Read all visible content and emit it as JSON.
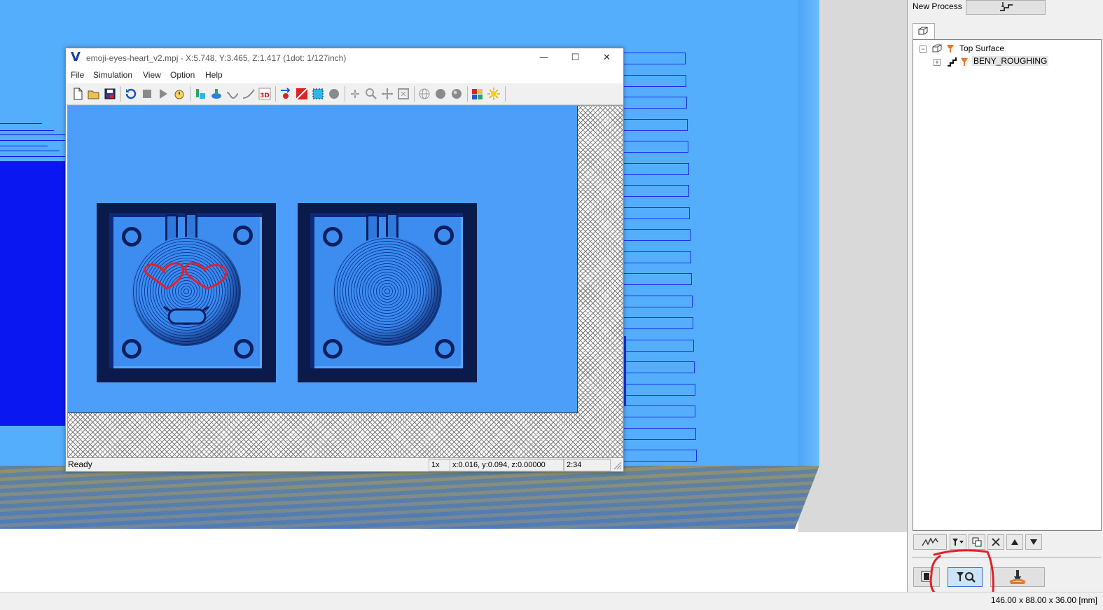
{
  "sim_window": {
    "title": "emoji-eyes-heart_v2.mpj - X:5.748, Y:3.465, Z:1.417 (1dot: 1/127inch)",
    "controls": {
      "minimize": "—",
      "maximize": "☐",
      "close": "✕"
    },
    "menu": [
      "File",
      "Simulation",
      "View",
      "Option",
      "Help"
    ],
    "toolbar_icons": [
      "new-file-icon",
      "open-folder-icon",
      "save-icon",
      "reset-simulation-icon",
      "stop-icon",
      "play-icon",
      "step-icon",
      "tool-view-icon",
      "stock-view-icon",
      "toolpath-icon",
      "path-line-icon",
      "3d-view-icon",
      "cut-direction-icon",
      "color-map-icon",
      "select-area-icon",
      "shade-icon",
      "pan-icon",
      "zoom-icon",
      "move-icon",
      "fit-view-icon",
      "sphere-wire-icon",
      "sphere-solid-icon",
      "sphere-shaded-icon",
      "color-palette-icon",
      "light-icon"
    ],
    "status": {
      "state": "Ready",
      "zoom": "1x",
      "coords": "x:0.016, y:0.094, z:0.00000",
      "time": "2:34"
    }
  },
  "right_panel": {
    "new_process_label": "New Process",
    "tree": {
      "root": "Top Surface",
      "child": "BENY_ROUGHING"
    },
    "bottom_tools": [
      "toolpath-pattern-icon",
      "tool-dropdown-icon",
      "copy-icon",
      "delete-icon",
      "move-up-icon",
      "move-down-icon"
    ],
    "mode_buttons": [
      "stock-mode-icon",
      "tool-search-icon",
      "machine-tool-icon"
    ]
  },
  "dimensions": "146.00 x 88.00 x 36.00 [mm]",
  "colors": {
    "stock_blue": "#55aefb",
    "sim_blue": "#4d9ef9",
    "deep_blue": "#0b17f0",
    "annotation_red": "#e3202b"
  }
}
